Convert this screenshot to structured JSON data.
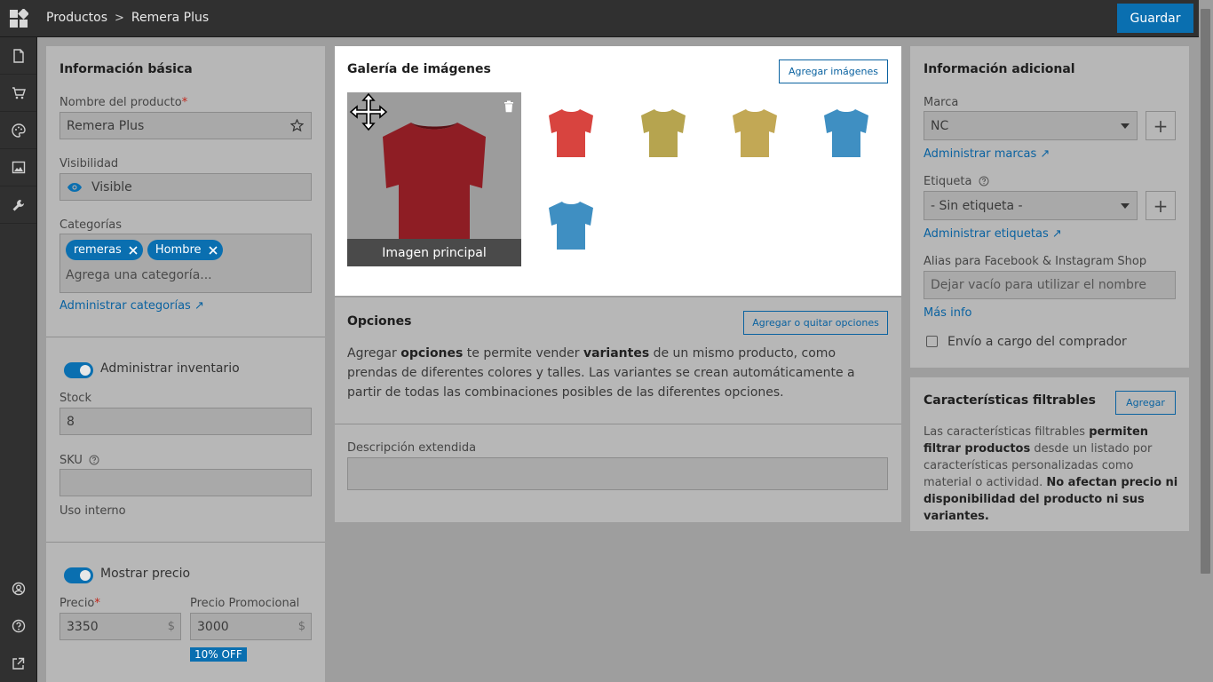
{
  "header": {
    "breadcrumb": [
      "Productos",
      "Remera Plus"
    ],
    "breadcrumb_sep": ">",
    "save_label": "Guardar"
  },
  "sidebar": {
    "items": [
      "dashboard-icon",
      "document-icon",
      "cart-icon",
      "palette-icon",
      "image-icon",
      "tools-icon",
      "user-circle-icon",
      "help-icon",
      "external-link-icon"
    ]
  },
  "basic": {
    "title": "Información básica",
    "name_label": "Nombre del producto",
    "required_mark": "*",
    "name_value": "Remera Plus",
    "visibility_label": "Visibilidad",
    "visibility_value": "Visible",
    "categories_label": "Categorías",
    "categories": [
      "remeras",
      "Hombre"
    ],
    "category_placeholder": "Agrega una categoría...",
    "manage_categories": "Administrar categorías ↗"
  },
  "inventory": {
    "toggle_label": "Administrar inventario",
    "stock_label": "Stock",
    "stock_value": "8",
    "sku_label": "SKU",
    "sku_value": "",
    "sku_hint": "Uso interno"
  },
  "pricing": {
    "toggle_label": "Mostrar precio",
    "price_label": "Precio",
    "price_value": "3350",
    "promo_label": "Precio Promocional",
    "promo_value": "3000",
    "currency": "$",
    "discount_badge": "10% OFF"
  },
  "gallery": {
    "title": "Galería de imágenes",
    "add_button": "Agregar imágenes",
    "main_caption": "Imagen principal",
    "thumbnails": [
      {
        "color": "#d8443f"
      },
      {
        "color": "#b6a44f"
      },
      {
        "color": "#c2a855"
      },
      {
        "color": "#3f8fc2"
      },
      {
        "color": "#3f8fc2"
      }
    ],
    "main_color": "#8e1d24"
  },
  "options": {
    "title": "Opciones",
    "button": "Agregar o quitar opciones",
    "text_1": "Agregar ",
    "bold_1": "opciones",
    "text_2": " te permite vender ",
    "bold_2": "variantes",
    "text_3": " de un mismo producto, como prendas de diferentes colores y talles. Las variantes se crean automáticamente a partir de todas las combinaciones posibles de las diferentes opciones."
  },
  "description": {
    "label": "Descripción extendida",
    "value": ""
  },
  "additional": {
    "title": "Información adicional",
    "brand_label": "Marca",
    "brand_value": "NC",
    "manage_brands": "Administrar marcas ↗",
    "tag_label": "Etiqueta",
    "tag_value": "- Sin etiqueta -",
    "manage_tags": "Administrar etiquetas ↗",
    "alias_label": "Alias para Facebook & Instagram Shop",
    "alias_placeholder": "Dejar vacío para utilizar el nombre",
    "more_info": "Más info",
    "shipping_label": "Envío a cargo del comprador",
    "plus": "+"
  },
  "filters": {
    "title": "Características filtrables",
    "button": "Agregar",
    "t1": "Las características filtrables ",
    "b1": "permiten filtrar productos",
    "t2": " desde un listado por características personalizadas como material o actividad. ",
    "b2": "No afectan precio ni disponibilidad del producto ni sus variantes."
  },
  "colors": {
    "accent": "#0a6fb0",
    "topbar": "#303030"
  }
}
